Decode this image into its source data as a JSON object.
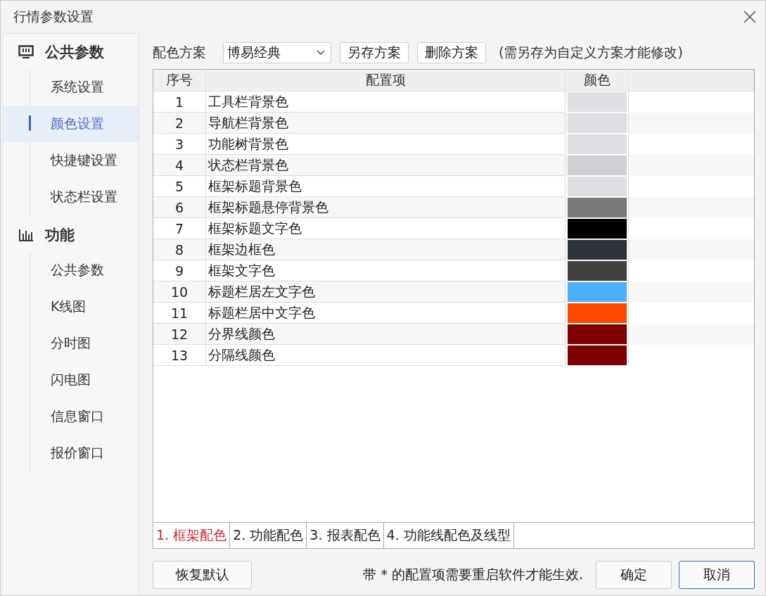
{
  "window": {
    "title": "行情参数设置"
  },
  "sidebar": {
    "groups": [
      {
        "label": "公共参数",
        "children": [
          {
            "label": "系统设置",
            "selected": false
          },
          {
            "label": "颜色设置",
            "selected": true
          },
          {
            "label": "快捷键设置",
            "selected": false
          },
          {
            "label": "状态栏设置",
            "selected": false
          }
        ]
      },
      {
        "label": "功能",
        "children": [
          {
            "label": "公共参数",
            "selected": false
          },
          {
            "label": "K线图",
            "selected": false
          },
          {
            "label": "分时图",
            "selected": false
          },
          {
            "label": "闪电图",
            "selected": false
          },
          {
            "label": "信息窗口",
            "selected": false
          },
          {
            "label": "报价窗口",
            "selected": false
          }
        ]
      }
    ]
  },
  "scheme": {
    "label": "配色方案",
    "value": "博易经典",
    "buttons": [
      "另存方案",
      "删除方案"
    ],
    "note": "(需另存为自定义方案才能修改)"
  },
  "table": {
    "columns": [
      "序号",
      "配置项",
      "颜色"
    ],
    "rows": [
      {
        "index": "1",
        "item": "工具栏背景色",
        "color": "#dfdfe3"
      },
      {
        "index": "2",
        "item": "导航栏背景色",
        "color": "#dfdfe3"
      },
      {
        "index": "3",
        "item": "功能树背景色",
        "color": "#dfdfe3"
      },
      {
        "index": "4",
        "item": "状态栏背景色",
        "color": "#d0d0d4"
      },
      {
        "index": "5",
        "item": "框架标题背景色",
        "color": "#dfdfe3"
      },
      {
        "index": "6",
        "item": "框架标题悬停背景色",
        "color": "#7a7a7a"
      },
      {
        "index": "7",
        "item": "框架标题文字色",
        "color": "#000000"
      },
      {
        "index": "8",
        "item": "框架边框色",
        "color": "#2d3239"
      },
      {
        "index": "9",
        "item": "框架文字色",
        "color": "#424242"
      },
      {
        "index": "10",
        "item": "标题栏居左文字色",
        "color": "#4cb0ff"
      },
      {
        "index": "11",
        "item": "标题栏居中文字色",
        "color": "#ff4a00"
      },
      {
        "index": "12",
        "item": "分界线颜色",
        "color": "#800000"
      },
      {
        "index": "13",
        "item": "分隔线颜色",
        "color": "#800000"
      }
    ]
  },
  "tabs": [
    {
      "label": "1. 框架配色",
      "selected": true
    },
    {
      "label": "2. 功能配色",
      "selected": false
    },
    {
      "label": "3. 报表配色",
      "selected": false
    },
    {
      "label": "4. 功能线配色及线型",
      "selected": false
    }
  ],
  "footer": {
    "reset": "恢复默认",
    "note": "带 * 的配置项需要重启软件才能生效.",
    "ok": "确定",
    "cancel": "取消"
  }
}
